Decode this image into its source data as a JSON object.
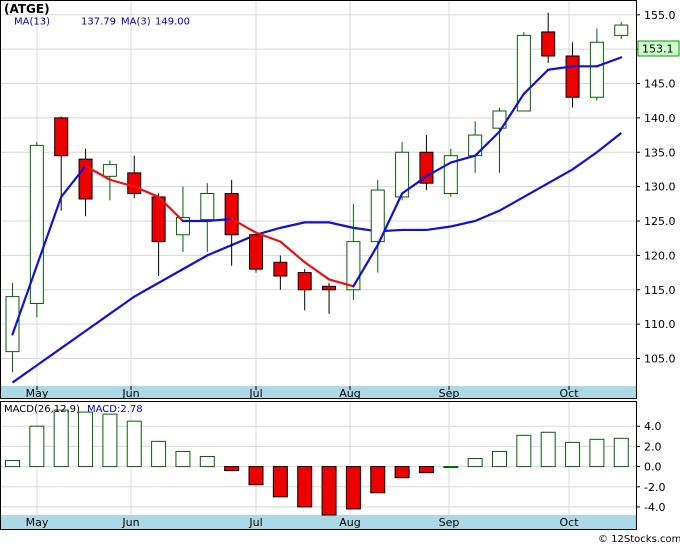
{
  "chart_data": {
    "type": "candlestick",
    "title": "(ATGE)",
    "watermark": "© 12Stocks.com",
    "x_ticks": [
      "May",
      "Jun",
      "Jul",
      "Aug",
      "Sep",
      "Oct"
    ],
    "price_panel": {
      "legend": {
        "ma13_label": "MA(13)",
        "ma13_value": "137.79",
        "ma3_label": "MA(3)",
        "ma3_value": "149.00"
      },
      "ylim": [
        101,
        157
      ],
      "y_ticks": [
        "155.0",
        "150.0",
        "145.0",
        "140.0",
        "135.0",
        "130.0",
        "125.0",
        "120.0",
        "115.0",
        "110.0",
        "105.0"
      ],
      "last_price_label": "153.1",
      "colors": {
        "up_border": "#006400",
        "down_fill": "#ee0000",
        "ma13": "#1010dd",
        "ma3_up": "#1010dd",
        "ma3_down": "#ee1111",
        "grid": "#d8d8d8",
        "axis_band": "#add8e6"
      },
      "candles": [
        {
          "open": 106.0,
          "high": 116.0,
          "low": 103.0,
          "close": 114.0
        },
        {
          "open": 113.0,
          "high": 136.5,
          "low": 111.0,
          "close": 136.0
        },
        {
          "open": 140.0,
          "high": 140.2,
          "low": 126.5,
          "close": 134.5
        },
        {
          "open": 134.0,
          "high": 135.5,
          "low": 125.7,
          "close": 128.2
        },
        {
          "open": 131.5,
          "high": 133.8,
          "low": 128.0,
          "close": 133.2
        },
        {
          "open": 132.0,
          "high": 134.5,
          "low": 128.3,
          "close": 129.0
        },
        {
          "open": 128.5,
          "high": 129.0,
          "low": 117.0,
          "close": 122.0
        },
        {
          "open": 123.0,
          "high": 130.0,
          "low": 120.5,
          "close": 125.5
        },
        {
          "open": 125.2,
          "high": 130.5,
          "low": 120.5,
          "close": 129.0
        },
        {
          "open": 129.0,
          "high": 131.0,
          "low": 118.5,
          "close": 123.0
        },
        {
          "open": 123.0,
          "high": 123.5,
          "low": 117.5,
          "close": 118.0
        },
        {
          "open": 119.0,
          "high": 120.0,
          "low": 115.0,
          "close": 117.0
        },
        {
          "open": 117.5,
          "high": 118.0,
          "low": 112.0,
          "close": 115.0
        },
        {
          "open": 115.5,
          "high": 116.0,
          "low": 111.5,
          "close": 115.0
        },
        {
          "open": 115.0,
          "high": 127.5,
          "low": 113.5,
          "close": 122.0
        },
        {
          "open": 122.0,
          "high": 131.0,
          "low": 117.5,
          "close": 129.5
        },
        {
          "open": 128.5,
          "high": 136.5,
          "low": 128.0,
          "close": 135.0
        },
        {
          "open": 135.0,
          "high": 137.5,
          "low": 129.5,
          "close": 130.5
        },
        {
          "open": 129.0,
          "high": 135.5,
          "low": 128.5,
          "close": 134.5
        },
        {
          "open": 134.5,
          "high": 139.5,
          "low": 132.0,
          "close": 137.5
        },
        {
          "open": 138.5,
          "high": 141.5,
          "low": 132.0,
          "close": 141.0
        },
        {
          "open": 141.0,
          "high": 152.5,
          "low": 141.0,
          "close": 152.0
        },
        {
          "open": 152.5,
          "high": 155.3,
          "low": 148.0,
          "close": 149.0
        },
        {
          "open": 149.0,
          "high": 151.0,
          "low": 141.5,
          "close": 143.0
        },
        {
          "open": 143.0,
          "high": 153.0,
          "low": 142.5,
          "close": 151.0
        },
        {
          "open": 152.0,
          "high": 154.0,
          "low": 151.5,
          "close": 153.5
        }
      ],
      "ma3": [
        108.5,
        118.5,
        128.5,
        133.0,
        131.0,
        130.0,
        128.5,
        125.0,
        125.0,
        125.3,
        123.3,
        122.0,
        119.0,
        116.5,
        115.5,
        121.5,
        129.0,
        131.5,
        133.5,
        134.5,
        138.0,
        143.5,
        147.0,
        147.5,
        147.5,
        148.8
      ],
      "ma13": [
        101.5,
        104.0,
        106.5,
        109.0,
        111.5,
        114.0,
        116.0,
        118.0,
        120.0,
        121.5,
        123.0,
        124.0,
        124.8,
        124.8,
        124.0,
        123.5,
        123.7,
        123.7,
        124.2,
        125.0,
        126.5,
        128.5,
        130.5,
        132.5,
        135.0,
        137.8
      ]
    },
    "macd_panel": {
      "legend": {
        "label": "MACD(26,12,9)",
        "value_label": "MACD:2.78"
      },
      "ylim": [
        -4.8,
        6.4
      ],
      "y_ticks": [
        "4.0",
        "2.0",
        "0.0",
        "-2.0",
        "-4.0"
      ],
      "bars": [
        0.6,
        4.0,
        5.6,
        5.4,
        5.2,
        4.5,
        2.5,
        1.5,
        1.0,
        -0.4,
        -1.8,
        -3.0,
        -4.0,
        -4.8,
        -4.2,
        -2.6,
        -1.1,
        -0.6,
        0.0,
        0.8,
        1.5,
        3.1,
        3.4,
        2.4,
        2.7,
        2.8
      ]
    }
  }
}
